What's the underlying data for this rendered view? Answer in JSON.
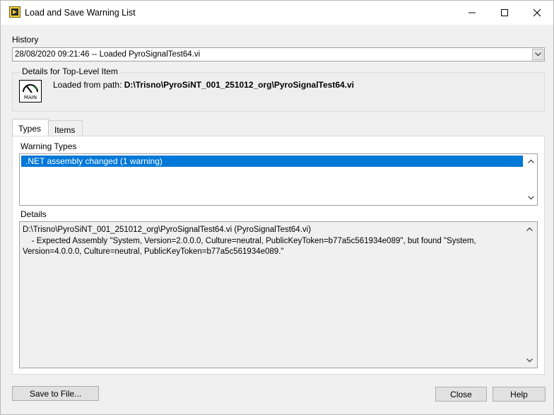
{
  "window": {
    "title": "Load and Save Warning List"
  },
  "history": {
    "label": "History",
    "selected": "28/08/2020 09:21:46 -- Loaded PyroSignalTest64.vi"
  },
  "top_level": {
    "label": "Details for Top-Level Item",
    "icon_text": "MAIN",
    "path_prefix": "Loaded from path:",
    "path_value": "D:\\Trisno\\PyroSiNT_001_251012_org\\PyroSignalTest64.vi"
  },
  "tabs": [
    {
      "label": "Types",
      "active": true
    },
    {
      "label": "Items",
      "active": false
    }
  ],
  "warning_types": {
    "label": "Warning Types",
    "items": [
      ".NET assembly changed (1 warning)"
    ]
  },
  "details": {
    "label": "Details",
    "text": "D:\\Trisno\\PyroSiNT_001_251012_org\\PyroSignalTest64.vi (PyroSignalTest64.vi)\n    - Expected Assembly \"System, Version=2.0.0.0, Culture=neutral, PublicKeyToken=b77a5c561934e089\", but found \"System,\nVersion=4.0.0.0, Culture=neutral, PublicKeyToken=b77a5c561934e089.\""
  },
  "buttons": {
    "save": "Save to File...",
    "close": "Close",
    "help": "Help"
  },
  "colors": {
    "selection": "#0078d7",
    "background": "#f0f0f0"
  }
}
